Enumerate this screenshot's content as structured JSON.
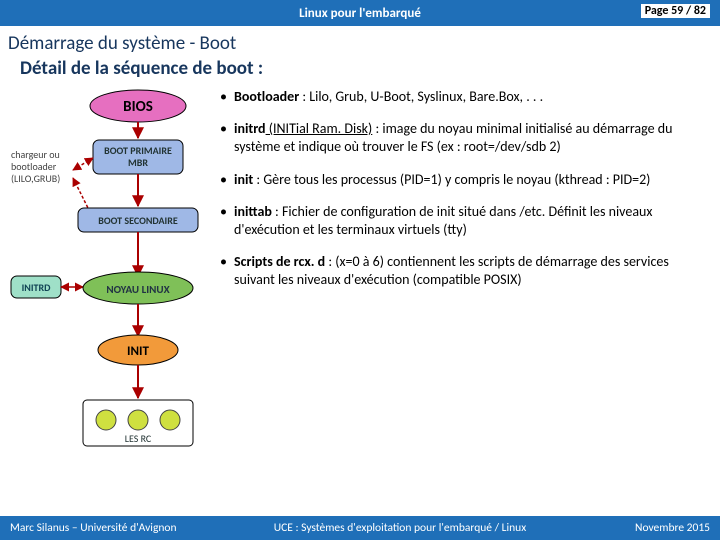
{
  "header": {
    "title": "Linux pour l'embarqué",
    "page": "Page 59 / 82"
  },
  "title": "Démarrage du système - Boot",
  "subtitle": "Détail  de la séquence de boot :",
  "diagram": {
    "labels": {
      "bios": "BIOS",
      "bootPrimary": "BOOT PRIMAIRE\nMBR",
      "loader": "chargeur ou\nbootloader\n(LILO,GRUB)",
      "bootSecondary": "BOOT SECONDAIRE",
      "initrd": "INITRD",
      "kernel": "NOYAU LINUX",
      "init": "INIT",
      "rc": "LES RC"
    }
  },
  "bullets": [
    {
      "term": "Bootloader",
      "text": " : Lilo, Grub, U-Boot, Syslinux, Bare.Box, . . ."
    },
    {
      "term": "initrd",
      "u": " (INITial Ram. Disk)",
      "text": " : image du noyau minimal initialisé au démarrage du système et indique où trouver le FS (ex : root=/dev/sdb 2)"
    },
    {
      "term": "init",
      "text": " : Gère tous les processus (PID=1) y compris le noyau (kthread : PID=2)"
    },
    {
      "term": "inittab",
      "text": " : Fichier de configuration de init situé dans /etc. Définit les niveaux d'exécution et les terminaux virtuels (tty)"
    },
    {
      "term": "Scripts de rcx. d",
      "text": " : (x=0 à 6) contiennent les scripts de démarrage des services suivant les niveaux d'exécution (compatible POSIX)"
    }
  ],
  "footer": {
    "left": "Marc Silanus – Université d'Avignon",
    "mid": "UCE : Systèmes d'exploitation pour l'embarqué / Linux",
    "right": "Novembre 2015"
  }
}
